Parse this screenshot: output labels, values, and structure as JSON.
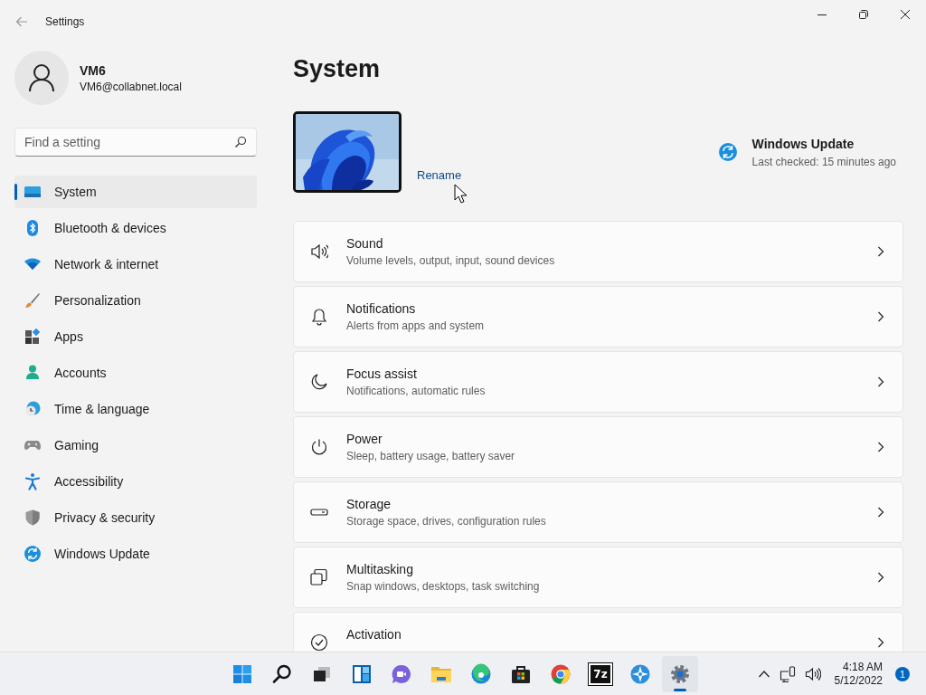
{
  "window": {
    "title": "Settings"
  },
  "profile": {
    "name": "VM6",
    "email": "VM6@collabnet.local"
  },
  "search": {
    "placeholder": "Find a setting"
  },
  "nav": [
    {
      "label": "System",
      "selected": true
    },
    {
      "label": "Bluetooth & devices",
      "selected": false
    },
    {
      "label": "Network & internet",
      "selected": false
    },
    {
      "label": "Personalization",
      "selected": false
    },
    {
      "label": "Apps",
      "selected": false
    },
    {
      "label": "Accounts",
      "selected": false
    },
    {
      "label": "Time & language",
      "selected": false
    },
    {
      "label": "Gaming",
      "selected": false
    },
    {
      "label": "Accessibility",
      "selected": false
    },
    {
      "label": "Privacy & security",
      "selected": false
    },
    {
      "label": "Windows Update",
      "selected": false
    }
  ],
  "page": {
    "title": "System",
    "device": {
      "action": "Rename"
    },
    "update": {
      "title": "Windows Update",
      "status": "Last checked: 15 minutes ago"
    },
    "settings": [
      {
        "title": "Sound",
        "description": "Volume levels, output, input, sound devices"
      },
      {
        "title": "Notifications",
        "description": "Alerts from apps and system"
      },
      {
        "title": "Focus assist",
        "description": "Notifications, automatic rules"
      },
      {
        "title": "Power",
        "description": "Sleep, battery usage, battery saver"
      },
      {
        "title": "Storage",
        "description": "Storage space, drives, configuration rules"
      },
      {
        "title": "Multitasking",
        "description": "Snap windows, desktops, task switching"
      },
      {
        "title": "Activation"
      }
    ]
  },
  "taskbar": {
    "apps": [
      {
        "running": false
      },
      {
        "running": false
      },
      {
        "running": false
      },
      {
        "running": false
      },
      {
        "running": false
      },
      {
        "running": false
      },
      {
        "running": false
      },
      {
        "running": false
      },
      {
        "running": false
      },
      {
        "label": "7z",
        "running": false
      },
      {
        "running": false
      },
      {
        "running": true
      }
    ],
    "clock": {
      "time": "4:18 AM",
      "date": "5/12/2022"
    },
    "notifications": "1"
  }
}
